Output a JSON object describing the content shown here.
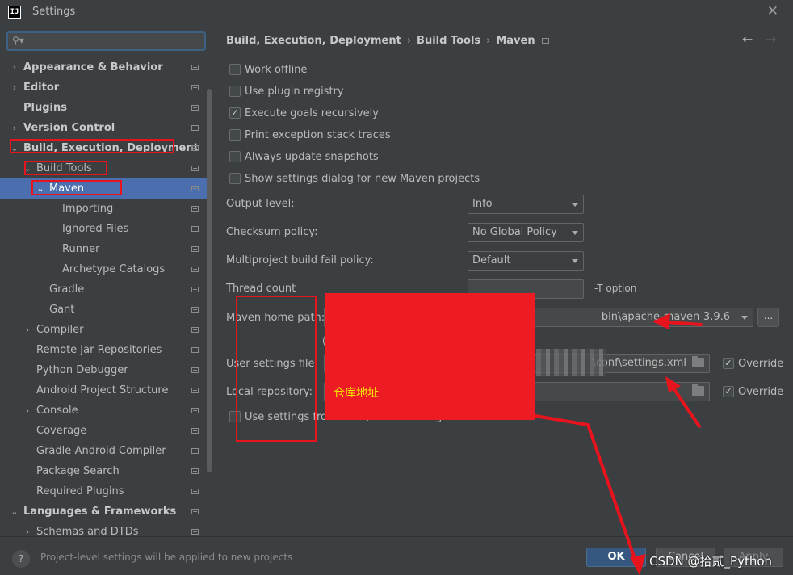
{
  "window": {
    "title": "Settings",
    "app_icon": "IJ"
  },
  "sidebar": {
    "search": {
      "value": ""
    },
    "items": [
      {
        "label": "Appearance & Behavior",
        "bold": true,
        "expandable": true,
        "expanded": false
      },
      {
        "label": "Editor",
        "bold": true,
        "expandable": true,
        "expanded": false
      },
      {
        "label": "Plugins",
        "bold": true,
        "expandable": false
      },
      {
        "label": "Version Control",
        "bold": true,
        "expandable": true,
        "expanded": false
      },
      {
        "label": "Build, Execution, Deployment",
        "bold": true,
        "expandable": true,
        "expanded": true
      },
      {
        "label": "Build Tools",
        "bold": false,
        "expandable": true,
        "expanded": true
      },
      {
        "label": "Maven",
        "bold": false,
        "expandable": true,
        "expanded": true,
        "selected": true
      },
      {
        "label": "Importing",
        "bold": false,
        "expandable": false
      },
      {
        "label": "Ignored Files",
        "bold": false,
        "expandable": false
      },
      {
        "label": "Runner",
        "bold": false,
        "expandable": false
      },
      {
        "label": "Archetype Catalogs",
        "bold": false,
        "expandable": false
      },
      {
        "label": "Gradle",
        "bold": false,
        "expandable": false
      },
      {
        "label": "Gant",
        "bold": false,
        "expandable": false
      },
      {
        "label": "Compiler",
        "bold": false,
        "expandable": true,
        "expanded": false
      },
      {
        "label": "Remote Jar Repositories",
        "bold": false,
        "expandable": false
      },
      {
        "label": "Python Debugger",
        "bold": false,
        "expandable": false
      },
      {
        "label": "Android Project Structure",
        "bold": false,
        "expandable": false
      },
      {
        "label": "Console",
        "bold": false,
        "expandable": true,
        "expanded": false
      },
      {
        "label": "Coverage",
        "bold": false,
        "expandable": false
      },
      {
        "label": "Gradle-Android Compiler",
        "bold": false,
        "expandable": false
      },
      {
        "label": "Package Search",
        "bold": false,
        "expandable": false
      },
      {
        "label": "Required Plugins",
        "bold": false,
        "expandable": false
      },
      {
        "label": "Languages & Frameworks",
        "bold": true,
        "expandable": true,
        "expanded": true
      },
      {
        "label": "Schemas and DTDs",
        "bold": false,
        "expandable": true,
        "expanded": false
      }
    ]
  },
  "breadcrumb": [
    "Build, Execution, Deployment",
    "Build Tools",
    "Maven"
  ],
  "options": [
    {
      "label": "Work offline",
      "checked": false
    },
    {
      "label": "Use plugin registry",
      "checked": false
    },
    {
      "label": "Execute goals recursively",
      "checked": true
    },
    {
      "label": "Print exception stack traces",
      "checked": false
    },
    {
      "label": "Always update snapshots",
      "checked": false
    },
    {
      "label": "Show settings dialog for new Maven projects",
      "checked": false
    }
  ],
  "fields": {
    "output_level": {
      "label": "Output level:",
      "value": "Info"
    },
    "checksum_policy": {
      "label": "Checksum policy:",
      "value": "No Global Policy"
    },
    "fail_policy": {
      "label": "Multiproject build fail policy:",
      "value": "Default"
    },
    "thread_count": {
      "label": "Thread count",
      "value": "",
      "hint": "-T option"
    },
    "maven_home": {
      "label": "Maven home path:",
      "value": "-bin\\apache-maven-3.9.6",
      "browse_label": "..."
    },
    "version_hint": "(",
    "user_settings": {
      "label": "User settings file:",
      "value": "\\conf\\settings.xml",
      "override_label": "Override",
      "override_checked": true
    },
    "local_repo": {
      "label": "Local repository:",
      "value": "",
      "override_label": "Override",
      "override_checked": true
    },
    "use_settings": {
      "label": "Use settings from .mvn/maven.config",
      "checked": false
    }
  },
  "annotation": {
    "redaction_text": "仓库地址",
    "color": "#e8141d"
  },
  "footer": {
    "help_label": "?",
    "text": "Project-level settings will be applied to new projects",
    "ok_label": "OK",
    "cancel_label": "Cancel",
    "apply_label": "Apply"
  },
  "watermark": "CSDN @拾贰_Python"
}
